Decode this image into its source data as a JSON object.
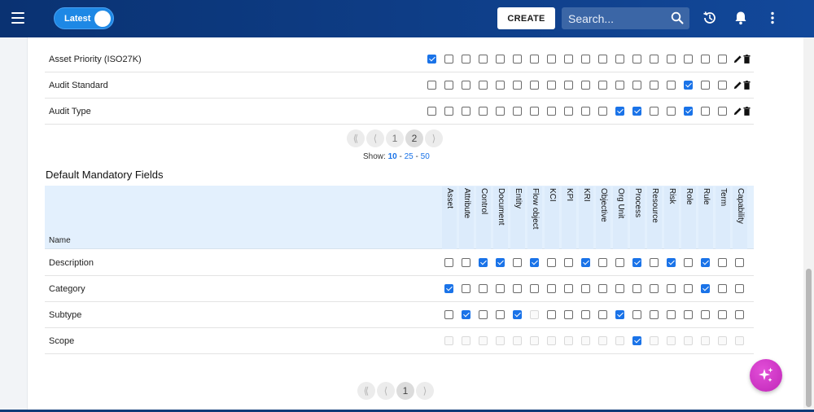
{
  "header": {
    "toggle_label": "Latest",
    "create_label": "CREATE",
    "search_placeholder": "Search..."
  },
  "top_table": {
    "rows": [
      {
        "name": "Asset Priority (ISO27K)",
        "checks": [
          1,
          0,
          0,
          0,
          0,
          0,
          0,
          0,
          0,
          0,
          0,
          0,
          0,
          0,
          0,
          0,
          0,
          0
        ]
      },
      {
        "name": "Audit Standard",
        "checks": [
          0,
          0,
          0,
          0,
          0,
          0,
          0,
          0,
          0,
          0,
          0,
          0,
          0,
          0,
          0,
          1,
          0,
          0
        ]
      },
      {
        "name": "Audit Type",
        "checks": [
          0,
          0,
          0,
          0,
          0,
          0,
          0,
          0,
          0,
          0,
          0,
          1,
          1,
          0,
          0,
          1,
          0,
          0
        ]
      }
    ],
    "pager": {
      "first": "⟪",
      "prev": "⟨",
      "pages": [
        "1",
        "2"
      ],
      "current": "2",
      "next": "⟩"
    },
    "show": {
      "label": "Show:",
      "options": [
        "10",
        "25",
        "50"
      ],
      "current": "10",
      "sep": "-"
    }
  },
  "mandatory": {
    "title": "Default Mandatory Fields",
    "name_header": "Name",
    "columns": [
      "Asset",
      "Attribute",
      "Control",
      "Document",
      "Entity",
      "Flow object",
      "KCI",
      "KPI",
      "KRI",
      "Objective",
      "Org Unit",
      "Process",
      "Resource",
      "Risk",
      "Role",
      "Rule",
      "Term",
      "Capability"
    ],
    "rows": [
      {
        "name": "Description",
        "checks": [
          0,
          0,
          1,
          1,
          0,
          1,
          0,
          0,
          1,
          0,
          0,
          1,
          0,
          1,
          0,
          1,
          0,
          0
        ],
        "disabled": []
      },
      {
        "name": "Category",
        "checks": [
          1,
          0,
          0,
          0,
          0,
          0,
          0,
          0,
          0,
          0,
          0,
          0,
          0,
          0,
          0,
          1,
          0,
          0
        ],
        "disabled": []
      },
      {
        "name": "Subtype",
        "checks": [
          0,
          1,
          0,
          0,
          1,
          0,
          0,
          0,
          0,
          0,
          1,
          0,
          0,
          0,
          0,
          0,
          0,
          0
        ],
        "disabled": [
          5
        ]
      },
      {
        "name": "Scope",
        "checks": [
          0,
          0,
          0,
          0,
          0,
          0,
          0,
          0,
          0,
          0,
          0,
          1,
          0,
          0,
          0,
          0,
          0,
          0
        ],
        "disabled": [
          0,
          1,
          2,
          3,
          4,
          5,
          6,
          7,
          8,
          9,
          10,
          11,
          12,
          13,
          14,
          15,
          16,
          17
        ]
      }
    ],
    "pager": {
      "first": "⟪",
      "prev": "⟨",
      "pages": [
        "1"
      ],
      "current": "1",
      "next": "⟩"
    }
  },
  "colors": {
    "accent": "#1a73e8",
    "topbar": "#0a3272",
    "fab": "#d03bc9"
  }
}
